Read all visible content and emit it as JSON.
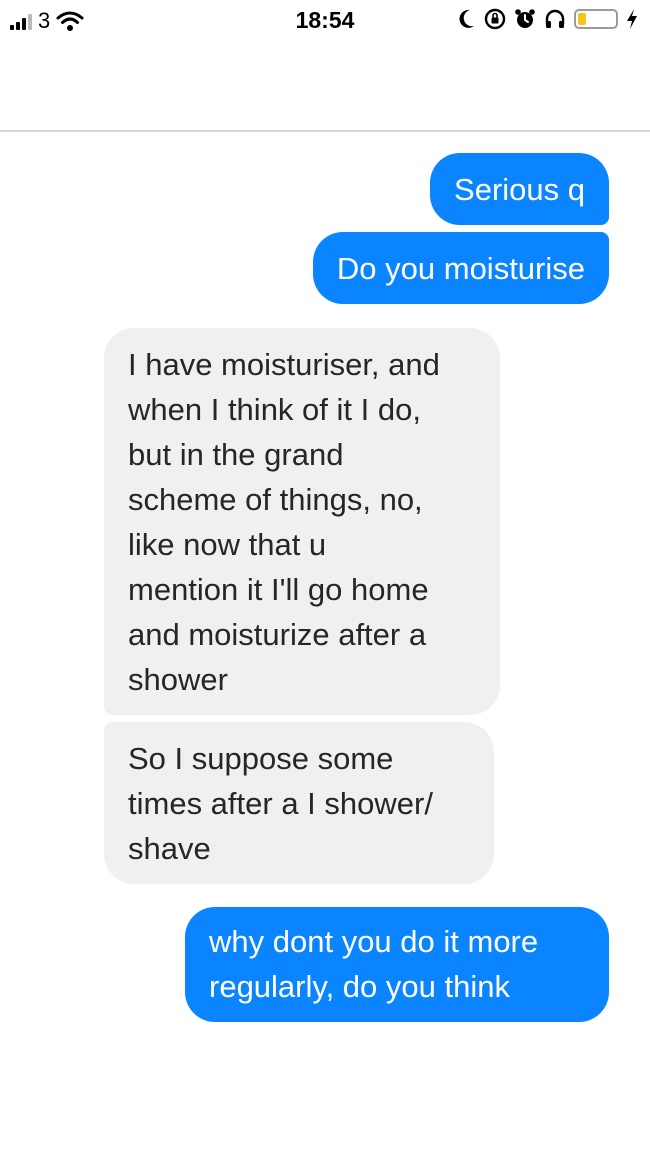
{
  "status_bar": {
    "carrier": "3",
    "time": "18:54",
    "battery_level": 0.2,
    "colors": {
      "battery": "#f5c518"
    }
  },
  "conversation": {
    "colors": {
      "outgoing": "#0b84ff",
      "incoming": "#f0f0f0"
    },
    "messages": [
      {
        "sender": "me",
        "text": "Serious q"
      },
      {
        "sender": "me",
        "text": "Do you moisturise"
      },
      {
        "sender": "them",
        "text": "I have moisturiser, and\nwhen I think of it I do,\nbut in the grand\nscheme of things, no,\nlike now that u\nmention it I'll go home\nand moisturize after a\nshower"
      },
      {
        "sender": "them",
        "text": "So I suppose some\ntimes after a I shower/\nshave"
      },
      {
        "sender": "me",
        "text": "why dont you do it more\nregularly, do you think"
      }
    ]
  }
}
